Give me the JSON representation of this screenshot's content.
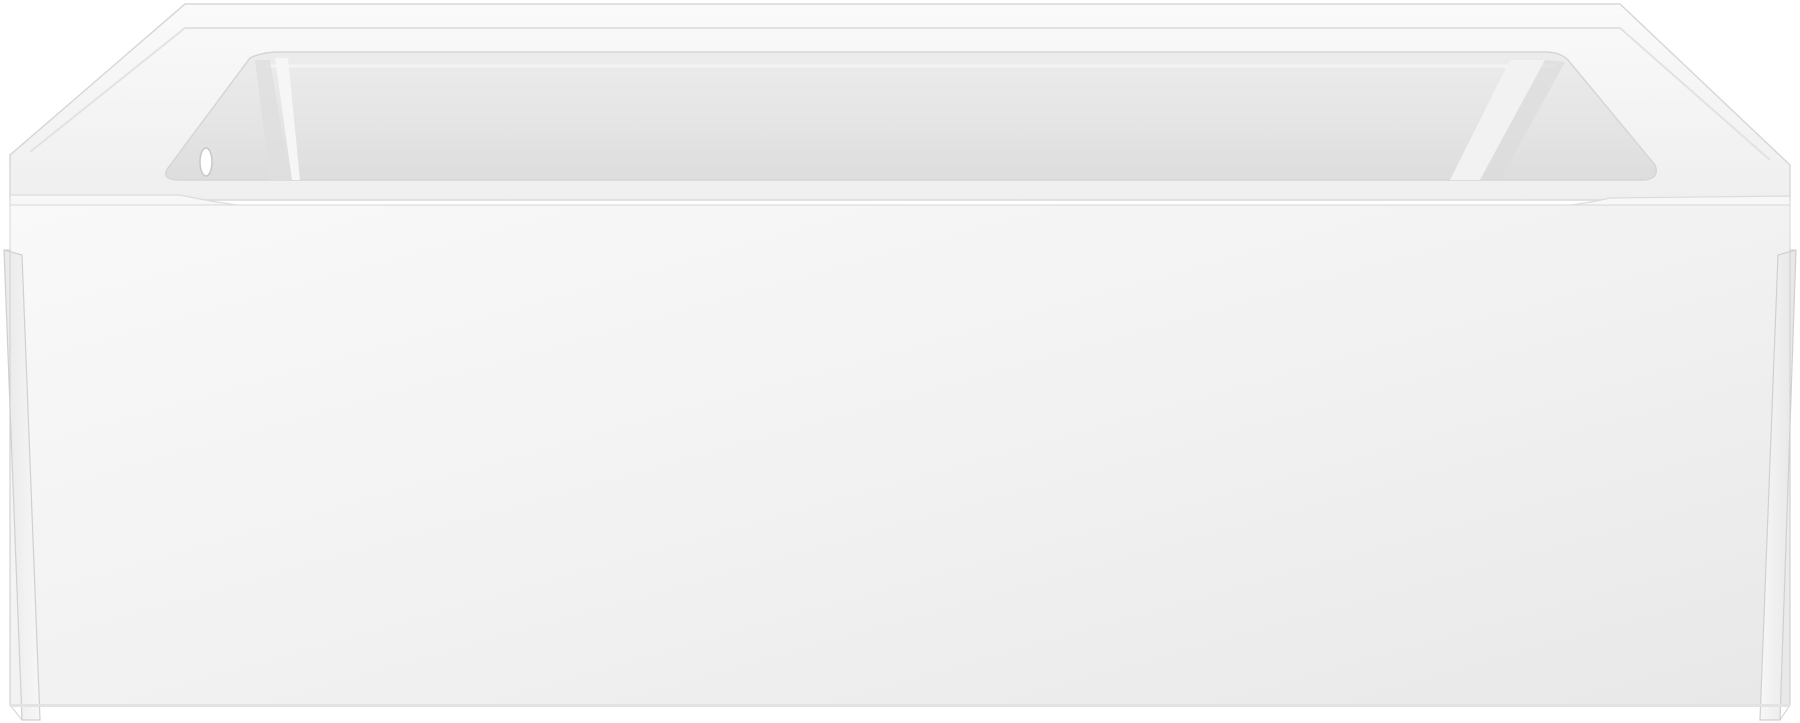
{
  "image": {
    "subject": "alcove-bathtub-with-apron",
    "colors": {
      "background": "#ffffff",
      "tub_body": "#f3f3f3",
      "tub_shadow": "#dcdcdc",
      "basin_inner": "#e6e6e6",
      "rim_highlight": "#fbfbfb",
      "edge_line": "#d2d2d2"
    }
  }
}
